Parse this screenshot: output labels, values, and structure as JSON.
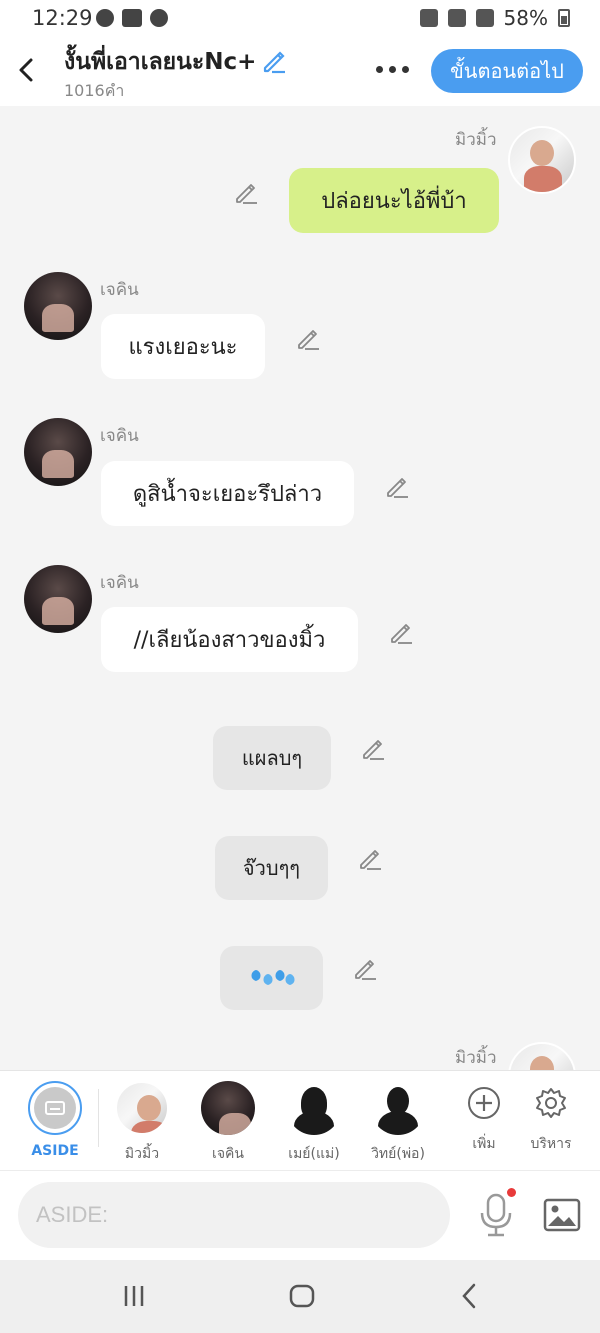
{
  "status_bar": {
    "time": "12:29",
    "battery": "58%"
  },
  "header": {
    "title": "งั้นพี่เอาเลยนะNc+",
    "word_count": "1016คำ",
    "next_button": "ขั้นตอนต่อไป",
    "accent_color": "#4a9df0"
  },
  "messages": [
    {
      "sender": "มิวมิ้ว",
      "text": "ปล่อยนะไอ้พี่บ้า",
      "side": "right",
      "style": "green"
    },
    {
      "sender": "เจคิน",
      "text": "แรงเยอะนะ",
      "side": "left",
      "style": "white"
    },
    {
      "sender": "เจคิน",
      "text": "ดูสิน้ำจะเยอะรึปล่าว",
      "side": "left",
      "style": "white"
    },
    {
      "sender": "เจคิน",
      "text": "//เลียน้องสาวของมิ้ว",
      "side": "left",
      "style": "white"
    },
    {
      "text": "แผลบๆ",
      "style": "aside"
    },
    {
      "text": "จ๊วบๆๆ",
      "style": "aside"
    },
    {
      "icon": "water-drops-icon",
      "style": "aside"
    },
    {
      "sender": "มิวมิ้ว",
      "side": "right",
      "partial": true
    }
  ],
  "cast_bar": {
    "aside_label": "ASIDE",
    "characters": [
      "มิวมิ้ว",
      "เจคิน",
      "เมย์(แม่)",
      "วิทย์(พ่อ)"
    ],
    "add_label": "เพิ่ม",
    "manage_label": "บริหาร"
  },
  "composer": {
    "placeholder": "ASIDE:"
  }
}
